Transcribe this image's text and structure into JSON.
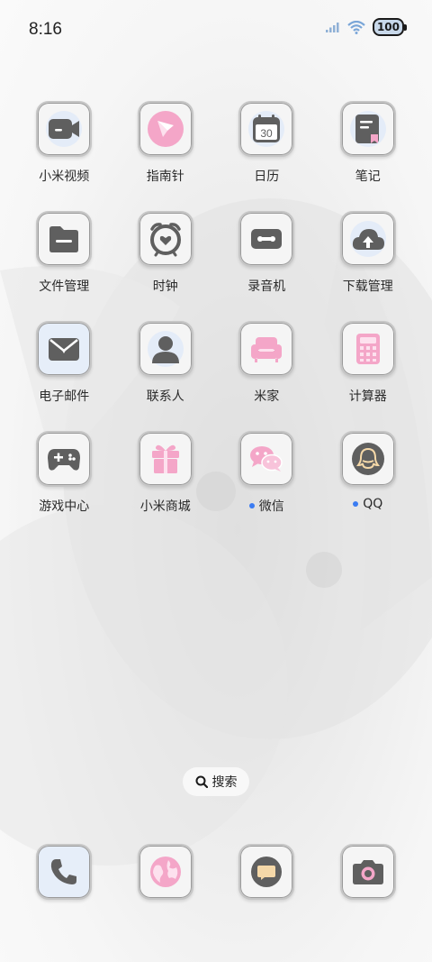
{
  "status_bar": {
    "time": "8:16",
    "battery": "100"
  },
  "apps": [
    {
      "name": "app-mi-video",
      "label": "小米视频",
      "icon": "video-camera-icon"
    },
    {
      "name": "app-compass",
      "label": "指南针",
      "icon": "compass-icon"
    },
    {
      "name": "app-calendar",
      "label": "日历",
      "icon": "calendar-icon",
      "day": "30"
    },
    {
      "name": "app-notes",
      "label": "笔记",
      "icon": "notebook-icon"
    },
    {
      "name": "app-file-manager",
      "label": "文件管理",
      "icon": "folder-icon"
    },
    {
      "name": "app-clock",
      "label": "时钟",
      "icon": "alarm-clock-icon"
    },
    {
      "name": "app-recorder",
      "label": "录音机",
      "icon": "cassette-icon"
    },
    {
      "name": "app-downloads",
      "label": "下载管理",
      "icon": "cloud-upload-icon"
    },
    {
      "name": "app-email",
      "label": "电子邮件",
      "icon": "envelope-icon"
    },
    {
      "name": "app-contacts",
      "label": "联系人",
      "icon": "person-icon"
    },
    {
      "name": "app-mi-home",
      "label": "米家",
      "icon": "sofa-icon"
    },
    {
      "name": "app-calculator",
      "label": "计算器",
      "icon": "calculator-icon"
    },
    {
      "name": "app-game-center",
      "label": "游戏中心",
      "icon": "gamepad-icon"
    },
    {
      "name": "app-mi-store",
      "label": "小米商城",
      "icon": "gift-icon"
    },
    {
      "name": "app-wechat",
      "label": "微信",
      "icon": "wechat-icon"
    },
    {
      "name": "app-qq",
      "label": "QQ",
      "icon": "qq-penguin-icon"
    }
  ],
  "search": {
    "label": "搜索"
  },
  "dock": [
    {
      "name": "dock-phone",
      "icon": "phone-icon"
    },
    {
      "name": "dock-browser",
      "icon": "globe-icon"
    },
    {
      "name": "dock-messages",
      "icon": "message-icon"
    },
    {
      "name": "dock-camera",
      "icon": "camera-icon"
    }
  ],
  "colors": {
    "accent_pink": "#f4a6c8",
    "icon_gray": "#5f5f5f",
    "notification_dot": "#3b7cf2"
  }
}
